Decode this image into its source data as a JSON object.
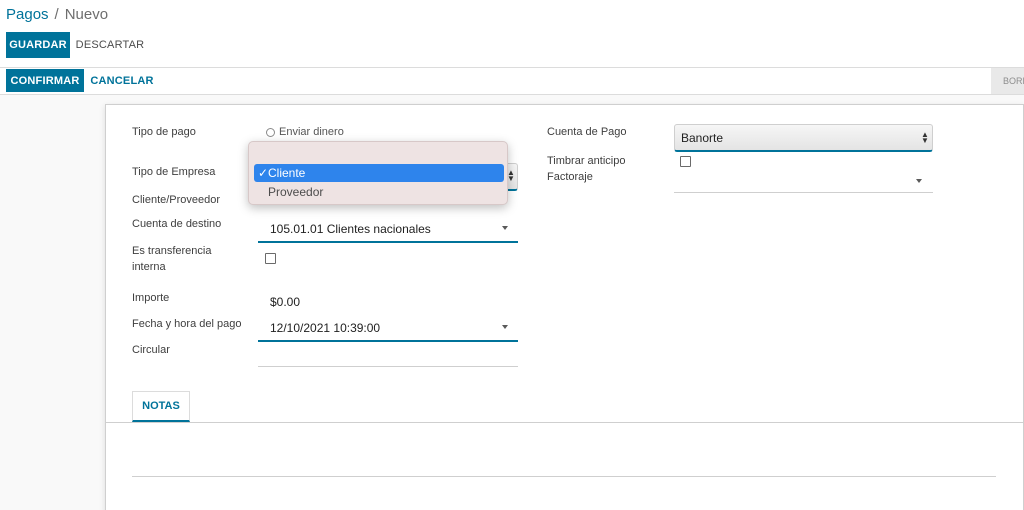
{
  "breadcrumb": {
    "parent": "Pagos",
    "separator": "/",
    "current": "Nuevo"
  },
  "toolbar": {
    "save_label": "GUARDAR",
    "discard_label": "DESCARTAR"
  },
  "statusbar": {
    "confirm_label": "CONFIRMAR",
    "cancel_label": "CANCELAR",
    "right_label": "BORR"
  },
  "form": {
    "tipo_pago": {
      "label": "Tipo de pago",
      "option_label": "Enviar dinero"
    },
    "tipo_empresa": {
      "label": "Tipo de Empresa"
    },
    "cliente_proveedor": {
      "label": "Cliente/Proveedor"
    },
    "cuenta_destino": {
      "label": "Cuenta de destino",
      "value": "105.01.01 Clientes nacionales"
    },
    "transferencia": {
      "label_line1": "Es transferencia",
      "label_line2": "interna"
    },
    "importe": {
      "label": "Importe",
      "value": "$0.00"
    },
    "fecha": {
      "label": "Fecha y hora del pago",
      "value": "12/10/2021 10:39:00"
    },
    "circular": {
      "label": "Circular"
    },
    "cuenta_pago": {
      "label": "Cuenta de Pago",
      "value": "Banorte"
    },
    "timbrar_anticipo": {
      "label": "Timbrar anticipo"
    },
    "factoraje": {
      "label": "Factoraje"
    }
  },
  "dropdown": {
    "items": [
      {
        "label": "Cliente",
        "check": "✓"
      },
      {
        "label": "Proveedor",
        "check": ""
      }
    ]
  },
  "tabs": {
    "notes_label": "NOTAS"
  },
  "colors": {
    "accent": "#00739a",
    "selection": "#2e84ec"
  }
}
